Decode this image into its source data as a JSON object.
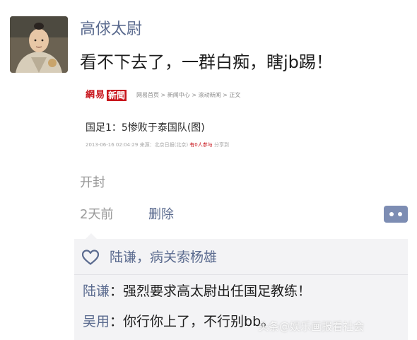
{
  "post": {
    "username": "高俅太尉",
    "text": "看不下去了，一群白痴，瞎jb踢！",
    "location": "开封",
    "time": "2天前",
    "delete_label": "删除"
  },
  "news_card": {
    "logo_part1": "網易",
    "logo_part2": "新聞",
    "breadcrumb": "网易首页 > 新闻中心 > 滚动新闻 > 正文",
    "headline": "国足1：5惨败于泰国队(图)",
    "meta_date": "2013-06-16 02:04:29",
    "meta_source": "来源：北京日报(北京)",
    "meta_participants": "有0人参与",
    "meta_share": "分享到"
  },
  "likes": {
    "names": "陆谦，病关索杨雄"
  },
  "comments": [
    {
      "author": "陆谦",
      "text": "强烈要求高太尉出任国足教练！"
    },
    {
      "author": "吴用",
      "text": "你行你上了，不行别bb。"
    }
  ],
  "colors": {
    "link_blue": "#5b6b8f",
    "netease_red": "#c8161d",
    "panel_bg": "#f3f3f5",
    "comment_button": "#7d8db3"
  },
  "watermark": "头条@娱乐画报看社会"
}
